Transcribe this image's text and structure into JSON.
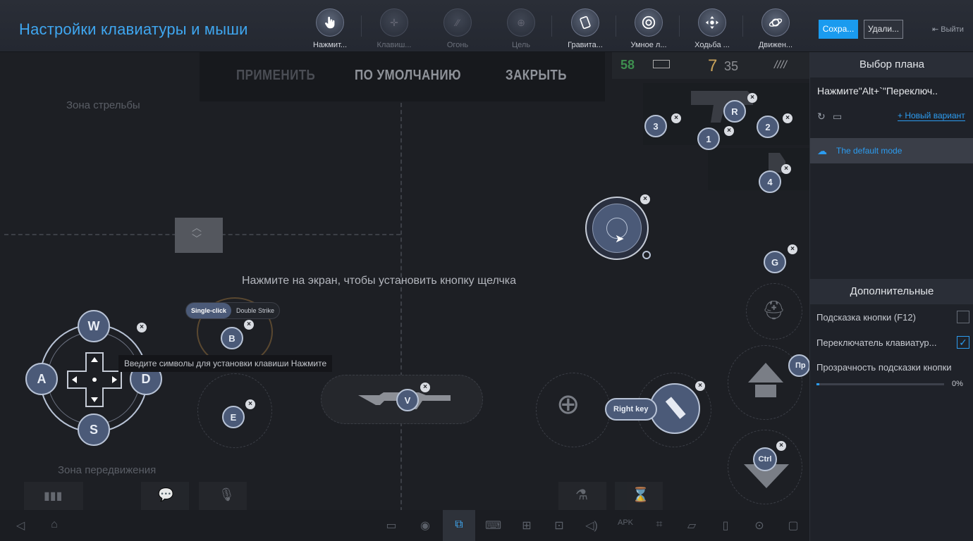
{
  "header": {
    "title": "Настройки клавиатуры и мыши",
    "tools": [
      {
        "label": "Нажмит...",
        "dim": false
      },
      {
        "label": "Клавиш...",
        "dim": true
      },
      {
        "label": "Огонь",
        "dim": true
      },
      {
        "label": "Цель",
        "dim": true
      },
      {
        "label": "Гравита...",
        "dim": false
      },
      {
        "label": "Умное л...",
        "dim": false
      },
      {
        "label": "Ходьба ...",
        "dim": false
      },
      {
        "label": "Движен...",
        "dim": false
      }
    ],
    "save_label": "Сохра...",
    "delete_label": "Удали...",
    "exit_label": "Выйти"
  },
  "canvas": {
    "overlay_menu": {
      "apply": "ПРИМЕНИТЬ",
      "default": "ПО УМОЛЧАНИЮ",
      "close": "ЗАКРЫТЬ"
    },
    "shoot_zone": "Зона стрельбы",
    "move_zone": "Зона передвижения",
    "center_hint": "Нажмите на экран, чтобы установить кнопку щелчка",
    "tooltip": "Введите символы для установки клавиши Нажмите",
    "click_type": {
      "single": "Single-click",
      "double": "Double Strike"
    },
    "hud": {
      "ping": "58",
      "ammo": "7",
      "ammo_total": "35"
    },
    "keys": {
      "w": "W",
      "a": "A",
      "s": "S",
      "d": "D",
      "b": "B",
      "e": "E",
      "v": "V",
      "r": "R",
      "k1": "1",
      "k2": "2",
      "k3": "3",
      "k4": "4",
      "g": "G",
      "ctrl": "Ctrl",
      "right_key": "Right key",
      "partial": "Пр"
    }
  },
  "panel": {
    "plan_title": "Выбор плана",
    "plan_hint": "Нажмите\"Alt+`\"Переключ..",
    "new_variant": "+ Новый вариант",
    "mode": "The default mode",
    "extra_title": "Дополнительные",
    "options": [
      {
        "label": "Подсказка кнопки (F12)",
        "checked": false
      },
      {
        "label": "Переключатель клавиатур...",
        "checked": true
      }
    ],
    "opacity_label": "Прозрачность подсказки кнопки",
    "opacity_value": "0%",
    "opacity_fraction": 0.0
  },
  "colors": {
    "accent": "#1a9bef",
    "title": "#3fa7f0",
    "key_fill": "#4b5a78"
  }
}
